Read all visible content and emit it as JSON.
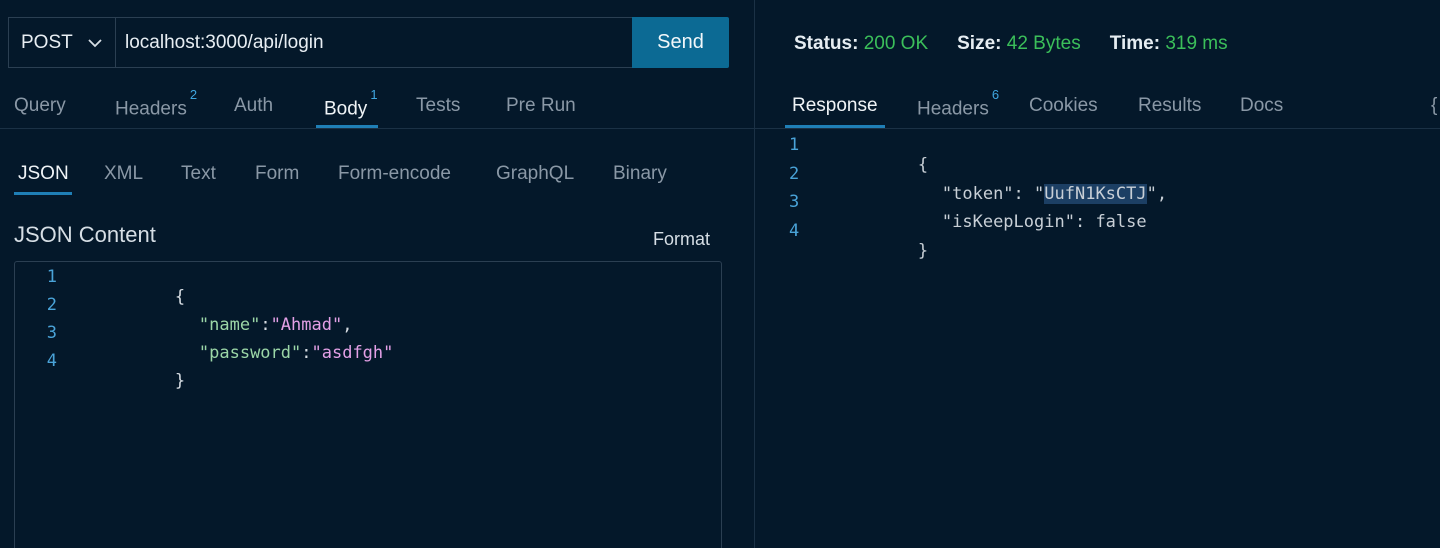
{
  "request": {
    "method": "POST",
    "url": "localhost:3000/api/login",
    "send_label": "Send"
  },
  "request_tabs": [
    {
      "label": "Query",
      "badge": ""
    },
    {
      "label": "Headers",
      "badge": "2"
    },
    {
      "label": "Auth",
      "badge": ""
    },
    {
      "label": "Body",
      "badge": "1",
      "active": true
    },
    {
      "label": "Tests",
      "badge": ""
    },
    {
      "label": "Pre Run",
      "badge": ""
    }
  ],
  "body_tabs": [
    "JSON",
    "XML",
    "Text",
    "Form",
    "Form-encode",
    "GraphQL",
    "Binary"
  ],
  "body_active": "JSON",
  "content_title": "JSON Content",
  "format_label": "Format",
  "request_body": {
    "line_numbers": [
      "1",
      "2",
      "3",
      "4"
    ],
    "open_brace": "{",
    "close_brace": "}",
    "name_key": "\"name\"",
    "name_value": "\"Ahmad\"",
    "password_key": "\"password\"",
    "password_value": "\"asdfgh\""
  },
  "response_status": {
    "status_label": "Status:",
    "status_value": "200 OK",
    "size_label": "Size:",
    "size_value": "42 Bytes",
    "time_label": "Time:",
    "time_value": "319 ms"
  },
  "response_tabs": [
    {
      "label": "Response",
      "badge": "",
      "active": true
    },
    {
      "label": "Headers",
      "badge": "6"
    },
    {
      "label": "Cookies",
      "badge": ""
    },
    {
      "label": "Results",
      "badge": ""
    },
    {
      "label": "Docs",
      "badge": ""
    }
  ],
  "response_body": {
    "line_numbers": [
      "1",
      "2",
      "3",
      "4"
    ],
    "open_brace": "{",
    "close_brace": "}",
    "token_key": "\"token\"",
    "token_value": "UufN1KsCTJ",
    "keep_key": "\"isKeepLogin\"",
    "keep_value": "false"
  },
  "edge_brace": "{",
  "colors": {
    "background": "#04182a",
    "accent": "#0c6a94",
    "tab_underline": "#1f7fb6",
    "status_ok": "#3bbf5a",
    "json_key": "#9bd6a7",
    "json_string": "#e3a0e6",
    "line_number": "#4aa3d8"
  }
}
